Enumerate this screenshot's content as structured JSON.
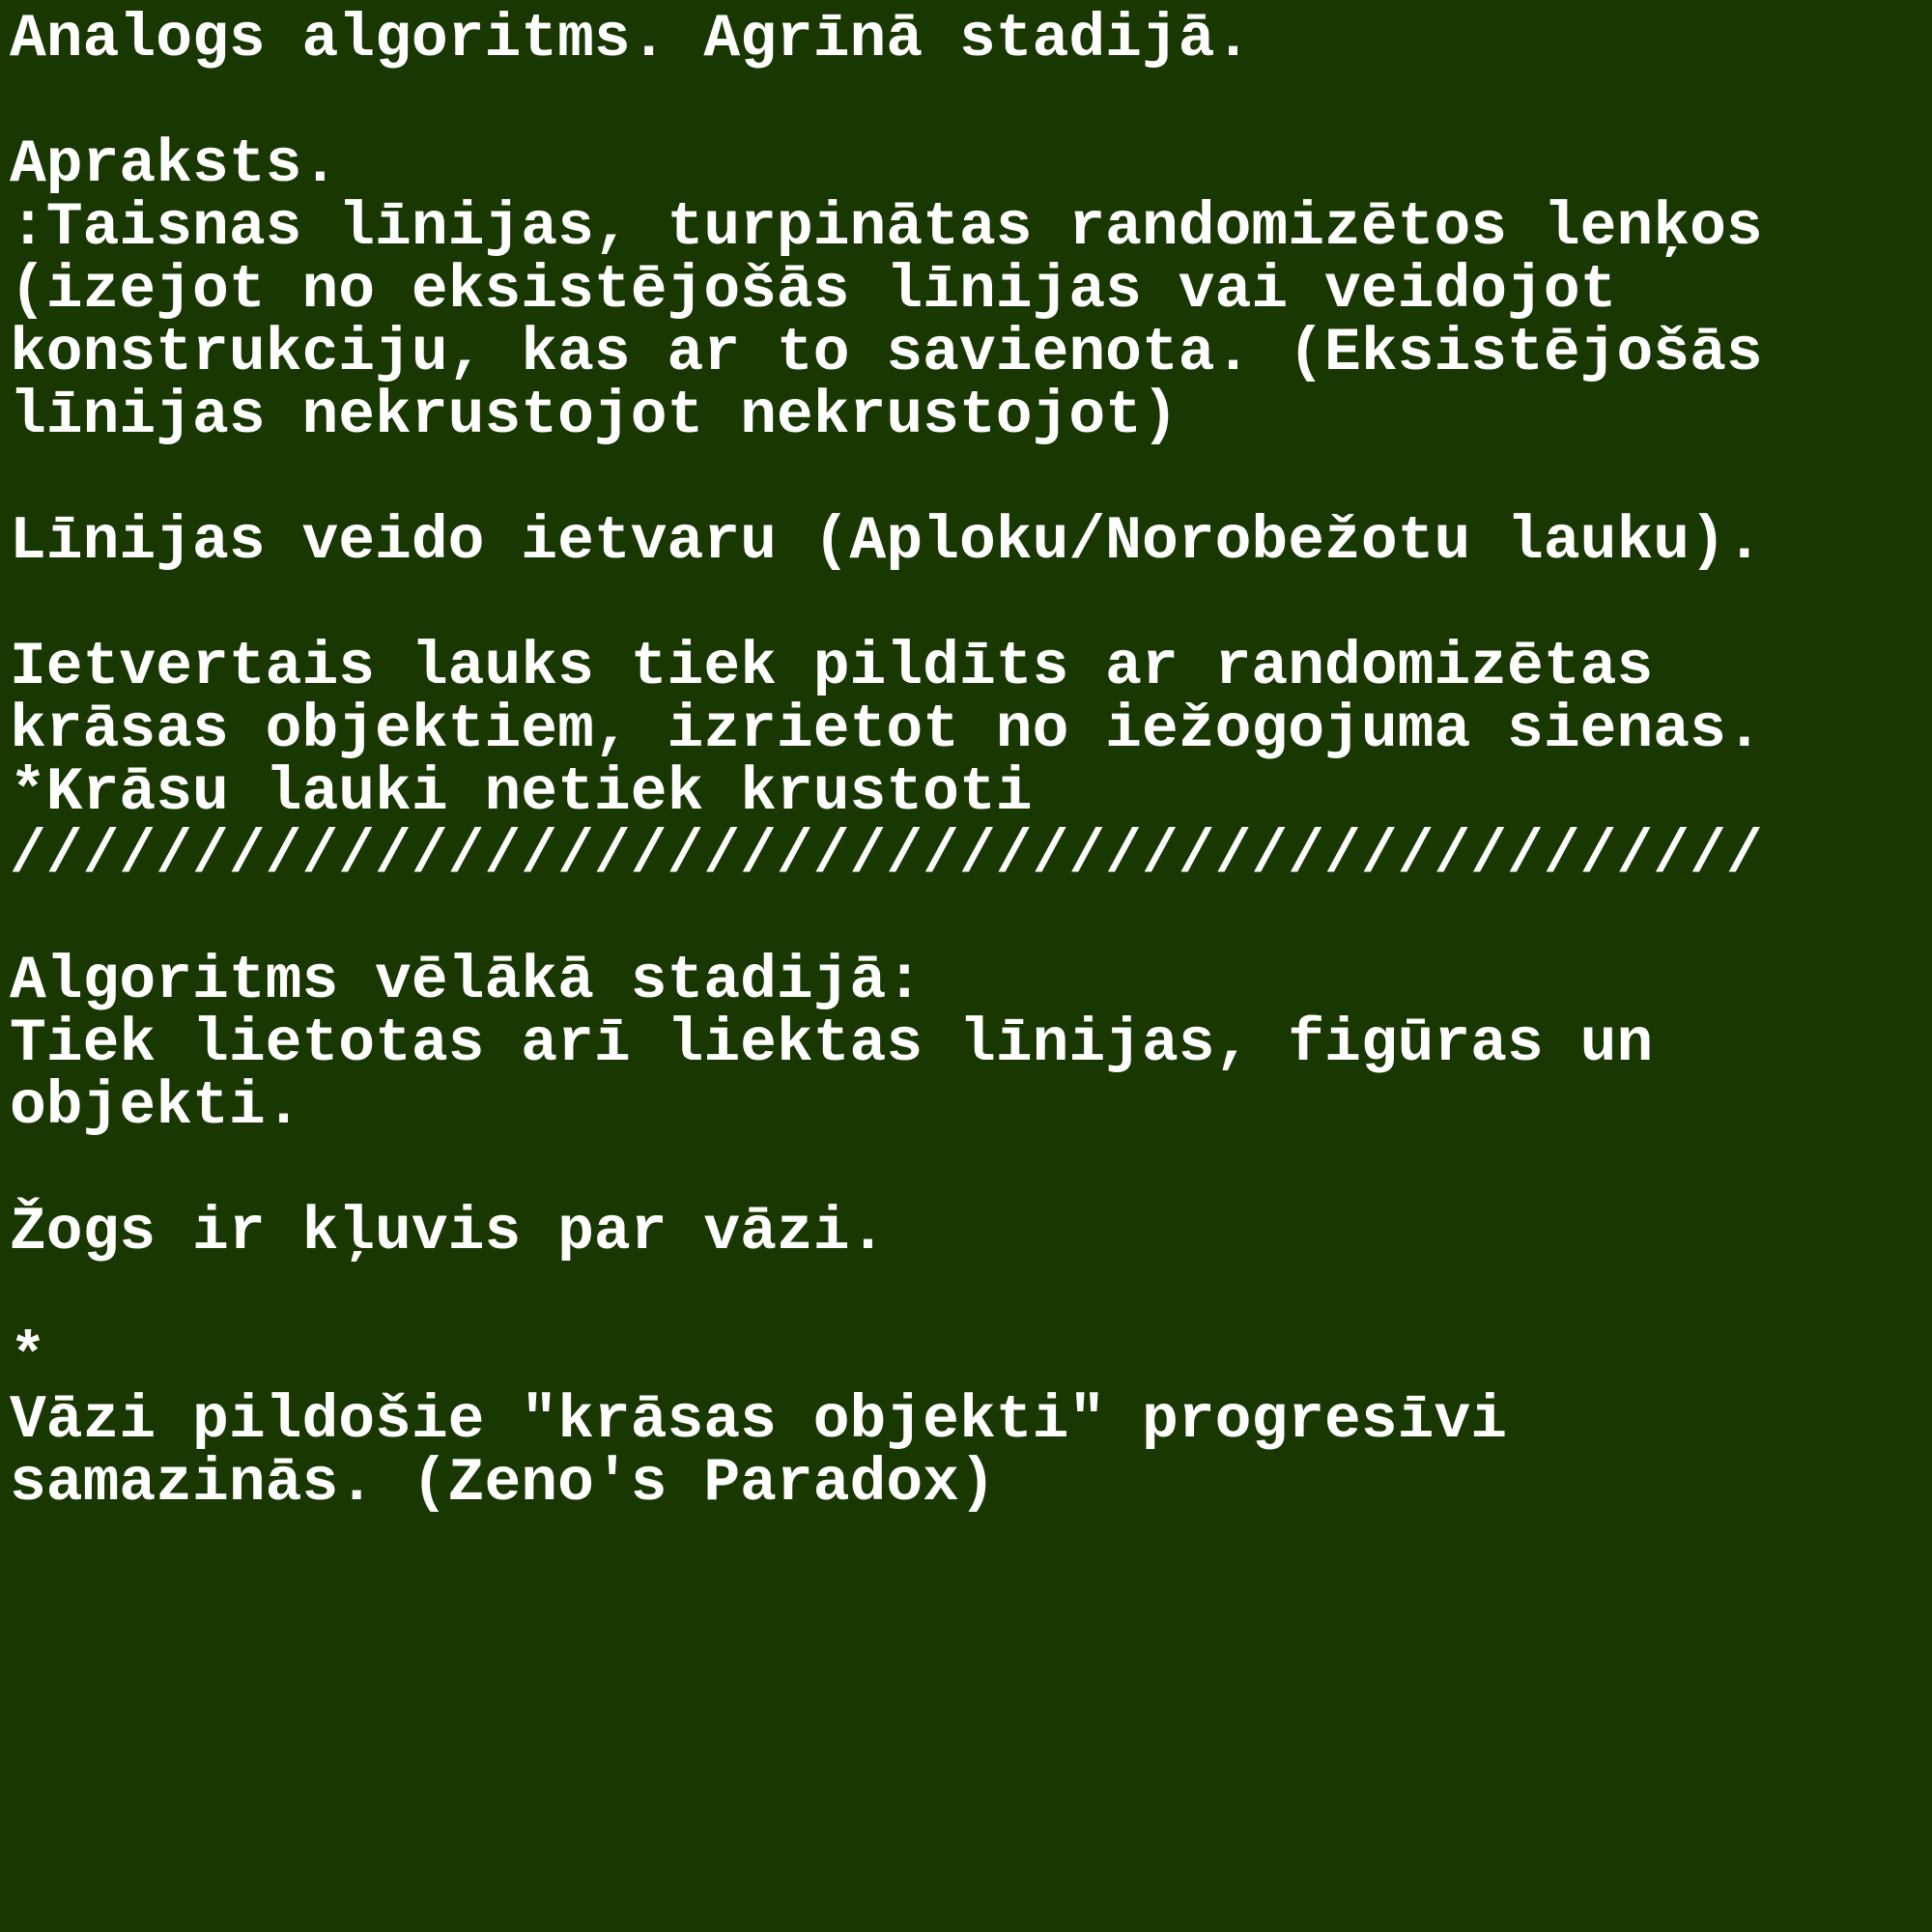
{
  "colors": {
    "background": "#183701",
    "text": "#ffffff"
  },
  "document": {
    "lines": [
      "Analogs algoritms. Agrīnā stadijā.",
      "",
      "Apraksts.",
      ":Taisnas līnijas, turpinātas randomizētos lenķos",
      "(izejot no eksistējošās līnijas vai veidojot",
      "konstrukciju, kas ar to savienota. (Eksistējošās",
      "līnijas nekrustojot nekrustojot)",
      "",
      "Līnijas veido ietvaru (Aploku/Norobežotu lauku).",
      "",
      "Ietvertais lauks tiek pildīts ar randomizētas",
      "krāsas objektiem, izrietot no iežogojuma sienas.",
      "*Krāsu lauki netiek krustoti",
      "////////////////////////////////////////////////",
      "",
      "Algoritms vēlākā stadijā:",
      "Tiek lietotas arī liektas līnijas, figūras un",
      "objekti.",
      "",
      "Žogs ir kļuvis par vāzi.",
      "",
      "*",
      "Vāzi pildošie \"krāsas objekti\" progresīvi",
      "samazinās. (Zeno's Paradox)"
    ]
  }
}
